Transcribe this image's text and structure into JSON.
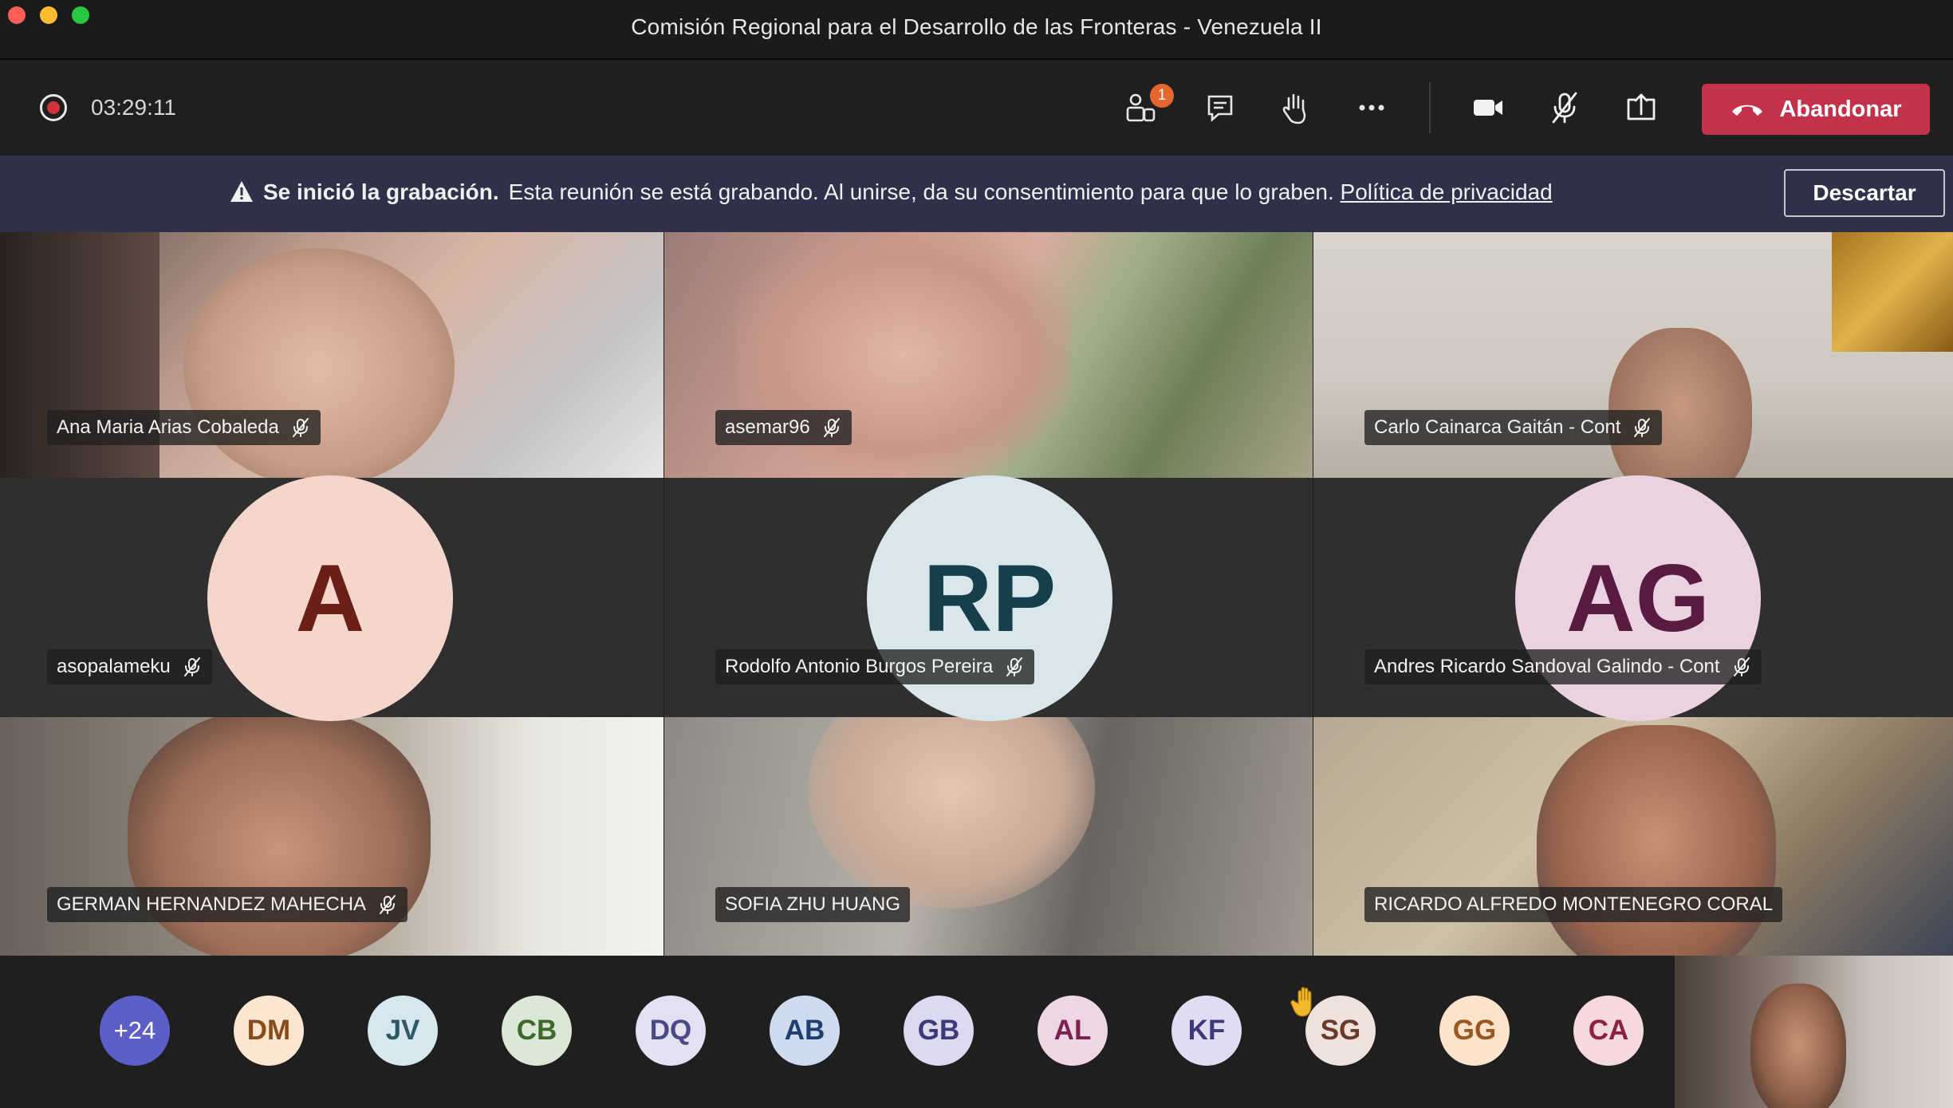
{
  "window": {
    "title": "Comisión Regional para el Desarrollo de las Fronteras - Venezuela II"
  },
  "toolbar": {
    "timer": "03:29:11",
    "participants_badge": "1",
    "leave_label": "Abandonar",
    "icons": [
      "record-icon",
      "participants-icon",
      "chat-icon",
      "raise-hand-icon",
      "more-icon",
      "camera-icon",
      "mic-off-icon",
      "share-icon",
      "phone-hangup-icon"
    ],
    "leave_color": "#c4314b"
  },
  "banner": {
    "title": "Se inició la grabación.",
    "message": "Esta reunión se está grabando. Al unirse, da su consentimiento para que lo graben.",
    "link": "Política de privacidad",
    "dismiss_label": "Descartar"
  },
  "tiles": [
    {
      "name": "Ana Maria Arias Cobaleda",
      "muted": true,
      "type": "video"
    },
    {
      "name": "asemar96",
      "muted": true,
      "type": "video"
    },
    {
      "name": "Carlo Cainarca Gaitán - Cont",
      "muted": true,
      "type": "video"
    },
    {
      "name": "asopalameku",
      "muted": true,
      "type": "avatar",
      "initials": "A",
      "bg": "#f4d6cc",
      "fg": "#6b1f16"
    },
    {
      "name": "Rodolfo Antonio Burgos Pereira",
      "muted": true,
      "type": "avatar",
      "initials": "RP",
      "bg": "#d9e7ea",
      "fg": "#153f4a"
    },
    {
      "name": "Andres Ricardo Sandoval Galindo - Cont",
      "muted": true,
      "type": "avatar",
      "initials": "AG",
      "bg": "#ead2e0",
      "fg": "#5a1b41"
    },
    {
      "name": "GERMAN HERNANDEZ MAHECHA",
      "muted": true,
      "type": "video"
    },
    {
      "name": "SOFIA ZHU HUANG",
      "muted": false,
      "type": "video"
    },
    {
      "name": "RICARDO ALFREDO MONTENEGRO CORAL",
      "muted": false,
      "type": "video"
    }
  ],
  "strip": [
    {
      "initials": "+24",
      "bg": "#5b5fc7",
      "fg": "#ffffff"
    },
    {
      "initials": "DM",
      "bg": "#fbe6d1",
      "fg": "#8a4b1a"
    },
    {
      "initials": "JV",
      "bg": "#d6e8ee",
      "fg": "#2d5866"
    },
    {
      "initials": "CB",
      "bg": "#dce8d6",
      "fg": "#3c6a2c"
    },
    {
      "initials": "DQ",
      "bg": "#e3e0f1",
      "fg": "#4a4a86"
    },
    {
      "initials": "AB",
      "bg": "#cfdcef",
      "fg": "#1f3f6e"
    },
    {
      "initials": "GB",
      "bg": "#dcdaf0",
      "fg": "#3c3a78"
    },
    {
      "initials": "AL",
      "bg": "#efd6e4",
      "fg": "#7a2352"
    },
    {
      "initials": "KF",
      "bg": "#e0ddf2",
      "fg": "#3c3a78"
    },
    {
      "initials": "SG",
      "bg": "#efe2dc",
      "fg": "#6b3b2a",
      "raised_hand": true
    },
    {
      "initials": "GG",
      "bg": "#fbe3cc",
      "fg": "#9a5820"
    },
    {
      "initials": "CA",
      "bg": "#f6d8df",
      "fg": "#8c2240"
    }
  ]
}
